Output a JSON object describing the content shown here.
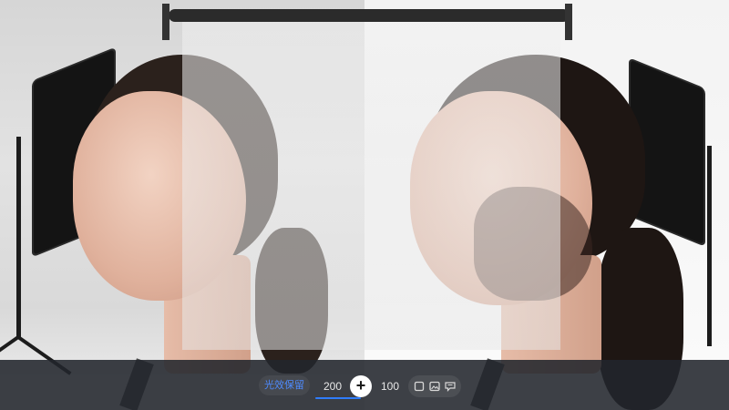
{
  "toolbar": {
    "mode_label": "光效保留",
    "left_value": "200",
    "right_value": "100",
    "add_label": "+",
    "icons": [
      "square-icon",
      "image-icon",
      "comment-icon"
    ],
    "accent_color": "#2f7dff"
  }
}
